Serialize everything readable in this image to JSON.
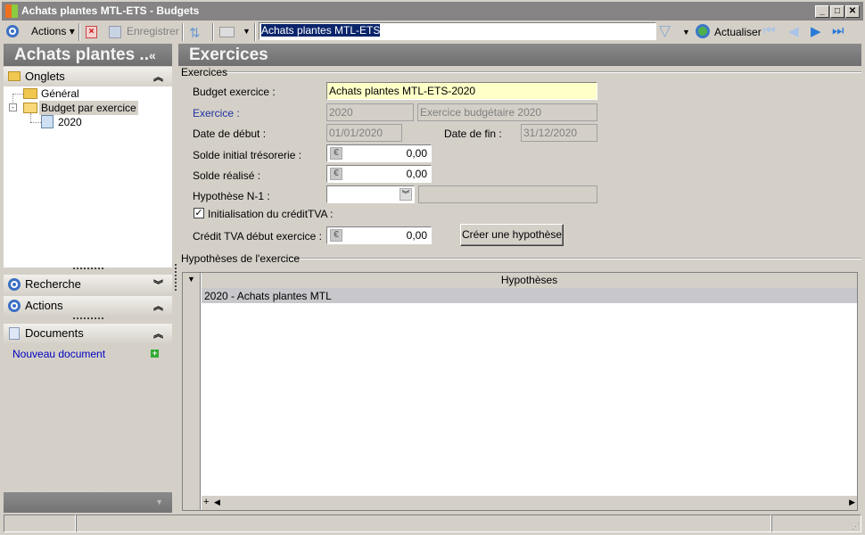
{
  "window": {
    "title": "Achats plantes MTL-ETS -  Budgets"
  },
  "toolbar": {
    "actions": "Actions",
    "save": "Enregistrer",
    "search_value": "Achats plantes MTL-ETS",
    "refresh": "Actualiser"
  },
  "left": {
    "title": "Achats plantes ..",
    "tabs_header": "Onglets",
    "tree": [
      "Général",
      "Budget par exercice",
      "2020"
    ],
    "search": "Recherche",
    "actions": "Actions",
    "documents": "Documents",
    "new_document": "Nouveau document"
  },
  "main": {
    "title": "Exercices",
    "group1": "Exercices",
    "budget_label": "Budget exercice :",
    "budget_value": "Achats plantes MTL-ETS-2020",
    "exercice_label": "Exercice :",
    "exercice_code": "2020",
    "exercice_desc": "Exercice budgétaire 2020",
    "start_label": "Date de début :",
    "start_value": "01/01/2020",
    "end_label": "Date de fin :",
    "end_value": "31/12/2020",
    "solde_init_label": "Solde initial trésorerie :",
    "solde_init_value": "0,00",
    "solde_real_label": "Solde réalisé :",
    "solde_real_value": "0,00",
    "hyp_label": "Hypothèse N-1 :",
    "hyp_value": "",
    "hyp_desc": "",
    "init_tva_label": "Initialisation du créditTVA :",
    "init_tva_checked": true,
    "credit_label": "Crédit TVA début exercice :",
    "credit_value": "0,00",
    "create_button": "Créer une hypothèse",
    "group2": "Hypothèses de l'exercice",
    "grid": {
      "column": "Hypothèses",
      "rows": [
        "2020 - Achats plantes MTL"
      ]
    }
  },
  "colors": {
    "title_bg": "#858383",
    "selected_row": "#c8c8cc",
    "required_field": "#ffffc8",
    "link": "#0000c0"
  }
}
